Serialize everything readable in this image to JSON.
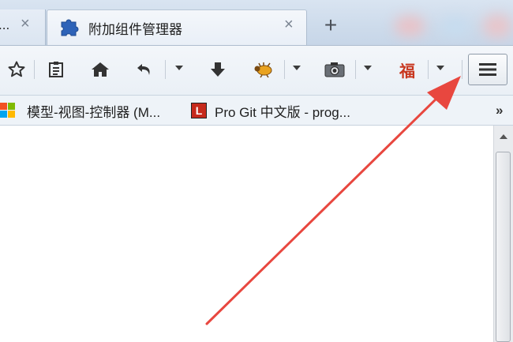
{
  "tabs": [
    {
      "title": "...",
      "close_label": "×"
    },
    {
      "title": "附加组件管理器",
      "close_label": "×",
      "icon": "puzzle-icon"
    }
  ],
  "new_tab_label": "+",
  "toolbar": {
    "icons": [
      "star-icon",
      "reading-list-icon",
      "home-icon",
      "undo-icon",
      "download-icon",
      "bug-icon",
      "camera-icon",
      "fu-icon",
      "hamburger-menu-icon"
    ],
    "fu_glyph": "福"
  },
  "bookmarks": [
    {
      "label": "模型-视图-控制器 (M...",
      "icon": "microsoft-icon"
    },
    {
      "label": "Pro Git 中文版 - prog...",
      "icon": "l-icon"
    }
  ],
  "bookmark_l_glyph": "L",
  "more_bookmarks": "»",
  "colors": {
    "arrow": "#e8473f",
    "tab_strip": "#cddbeb",
    "toolbar": "#eef3f8"
  }
}
